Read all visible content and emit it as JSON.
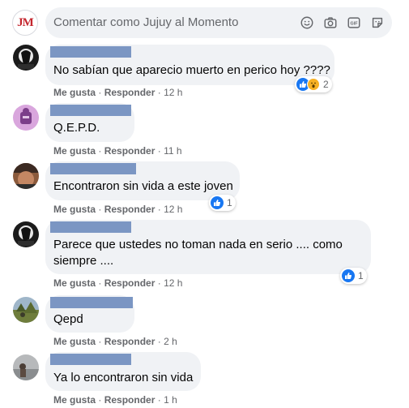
{
  "composer": {
    "avatar_text": "JM",
    "placeholder": "Comentar como Jujuy al Momento",
    "icons": [
      "emoji-icon",
      "camera-icon",
      "gif-icon",
      "sticker-icon"
    ]
  },
  "colors": {
    "bubble": "#f0f2f5",
    "name_redaction": "#7b96c3",
    "like_blue": "#1877f2",
    "meta_gray": "#65676b"
  },
  "comments": [
    {
      "text": "No sabían que aparecio muerto en perico hoy ????",
      "like": "Me gusta",
      "reply": "Responder",
      "sep": "·",
      "time": "12 h",
      "reactions": "2"
    },
    {
      "text": "Q.E.P.D.",
      "like": "Me gusta",
      "reply": "Responder",
      "sep": "·",
      "time": "11 h"
    },
    {
      "text": "Encontraron sin vida a este joven",
      "like": "Me gusta",
      "reply": "Responder",
      "sep": "·",
      "time": "12 h",
      "reactions": "1"
    },
    {
      "text": "Parece que ustedes no toman nada en serio .... como siempre ....",
      "like": "Me gusta",
      "reply": "Responder",
      "sep": "·",
      "time": "12 h",
      "reactions": "1"
    },
    {
      "text": "Qepd",
      "like": "Me gusta",
      "reply": "Responder",
      "sep": "·",
      "time": "2 h"
    },
    {
      "text": "Ya lo encontraron sin vida",
      "like": "Me gusta",
      "reply": "Responder",
      "sep": "·",
      "time": "1 h"
    }
  ]
}
